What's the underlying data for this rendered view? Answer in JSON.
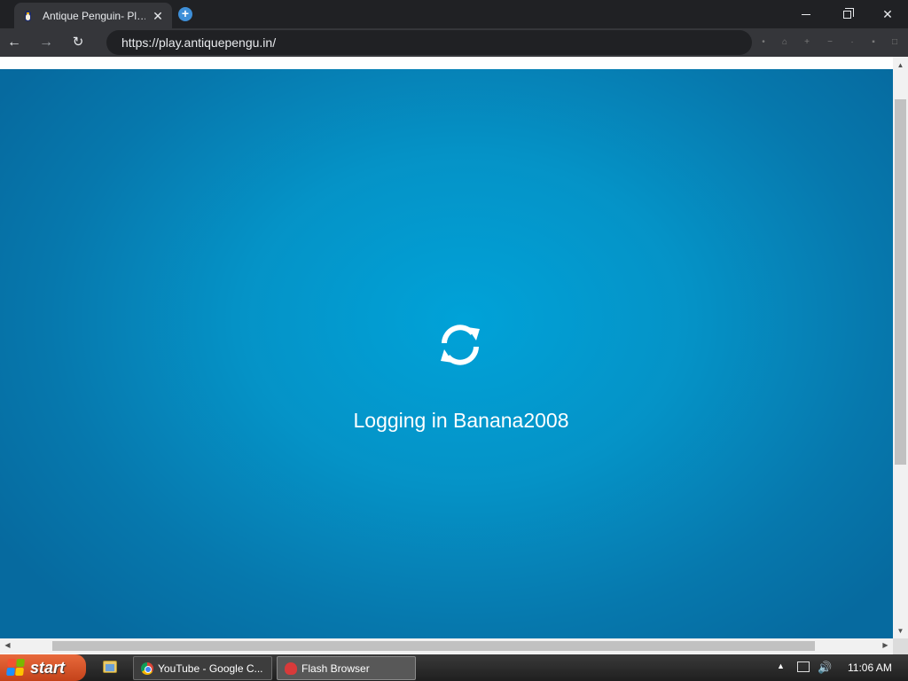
{
  "browser": {
    "tab": {
      "title": "Antique Penguin- Pl…",
      "close": "✕"
    },
    "new_tab": "+",
    "window_controls": {
      "close": "✕"
    },
    "nav": {
      "back": "←",
      "forward": "→",
      "reload": "↻"
    },
    "url": "https://play.antiquepengu.in/",
    "extension_icons": [
      "•",
      "⌂",
      "+",
      "−",
      "·",
      "▪",
      "□"
    ]
  },
  "game": {
    "status_text": "Logging in Banana2008",
    "spinner_icon": "sync-icon"
  },
  "scrollbars": {
    "up": "▲",
    "down": "▼",
    "left": "◀",
    "right": "▶"
  },
  "taskbar": {
    "start_label": "start",
    "tasks": [
      {
        "label": "YouTube - Google C...",
        "icon": "chrome-icon"
      },
      {
        "label": "Flash Browser",
        "icon": "flash-icon"
      }
    ],
    "tray_arrow": "▲",
    "volume": "🔊",
    "clock": "11:06 AM"
  },
  "colors": {
    "game_bg_center": "#00a2d8",
    "game_bg_edge": "#066a9f",
    "taskbar_start": "#d4532a"
  }
}
